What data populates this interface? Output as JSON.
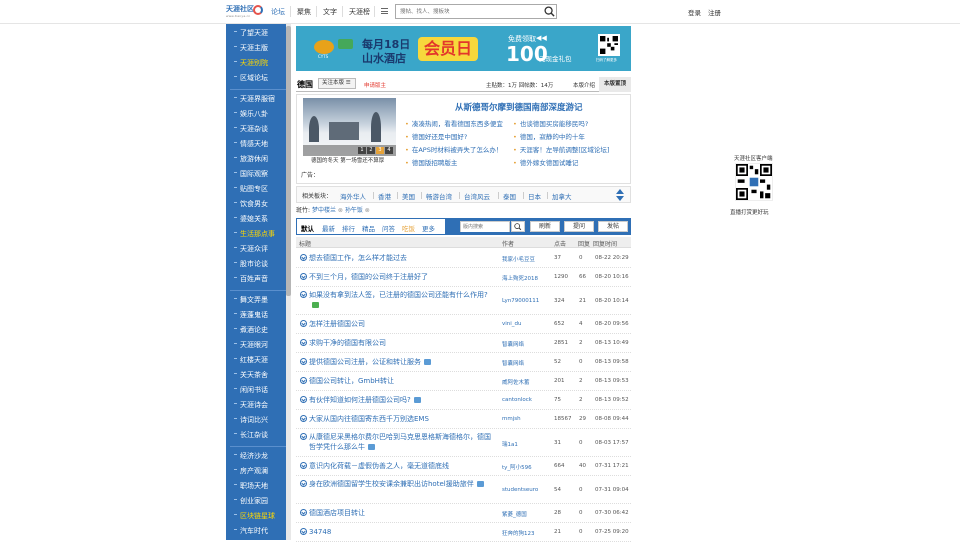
{
  "topbar": {
    "logo_text": "天涯社区",
    "logo_sub": "www.tianya.cn",
    "nav": [
      "论坛",
      "聚焦",
      "文字",
      "天涯榜"
    ],
    "search_placeholder": "搜帖、找人、搜板块",
    "login": "登录",
    "register": "注册"
  },
  "sidebar": {
    "items": [
      {
        "label": "了望天涯",
        "hl": false
      },
      {
        "label": "天涯主版",
        "hl": false
      },
      {
        "label": "天涯别院",
        "hl": true
      },
      {
        "label": "区域论坛",
        "hl": false
      },
      {
        "label": "天涯界服宿",
        "hl": false
      },
      {
        "label": "娱乐八卦",
        "hl": false
      },
      {
        "label": "天涯杂谈",
        "hl": false
      },
      {
        "label": "情感天地",
        "hl": false
      },
      {
        "label": "旅游休闲",
        "hl": false
      },
      {
        "label": "国际观察",
        "hl": false
      },
      {
        "label": "贴图专区",
        "hl": false
      },
      {
        "label": "饮食男女",
        "hl": false
      },
      {
        "label": "婆媳关系",
        "hl": false
      },
      {
        "label": "生活那点事",
        "hl": true
      },
      {
        "label": "天涯众评",
        "hl": false
      },
      {
        "label": "股市论谈",
        "hl": false
      },
      {
        "label": "百姓声音",
        "hl": false
      },
      {
        "label": "舞文弄墨",
        "hl": false
      },
      {
        "label": "莲蓬鬼话",
        "hl": false
      },
      {
        "label": "煮酒论史",
        "hl": false
      },
      {
        "label": "天涯眼河",
        "hl": false
      },
      {
        "label": "红楼天涯",
        "hl": false
      },
      {
        "label": "关天茶舍",
        "hl": false
      },
      {
        "label": "闲闲书话",
        "hl": false
      },
      {
        "label": "天涯诗会",
        "hl": false
      },
      {
        "label": "诗词比兴",
        "hl": false
      },
      {
        "label": "长江杂谈",
        "hl": false
      },
      {
        "label": "经济沙龙",
        "hl": false
      },
      {
        "label": "房产观澜",
        "hl": false
      },
      {
        "label": "职场天地",
        "hl": false
      },
      {
        "label": "创业家园",
        "hl": false
      },
      {
        "label": "区块链星球",
        "hl": true
      },
      {
        "label": "汽车时代",
        "hl": false
      }
    ]
  },
  "banner": {
    "brand": "CYTS",
    "brand_sub": "中青旅",
    "line1": "每月18日",
    "line2": "山水酒店",
    "tag": "会员日",
    "free": "免费领取",
    "amount": "100",
    "amount_sub": "元现金礼包",
    "qr_label": "扫码了解更多"
  },
  "board": {
    "name": "德国",
    "follow": "关注本版",
    "apply": "申请版主",
    "stats": "主贴数：1万 回帖数：14万",
    "intro": "本版介绍",
    "top_tab": "本版置顶"
  },
  "featured": {
    "title": "从斯德哥尔摩到德国南部深度游记",
    "photo_caption": "德国的冬天 第一场雪还不算厚",
    "slide_nums": [
      "1",
      "2",
      "3",
      "4"
    ],
    "links_left": [
      "凑凑热闹，看看德国东西多便宜",
      "德国好还是中国好?",
      "在APS时材料被弄失了怎么办！",
      "德国版招聘版主"
    ],
    "links_right": [
      "也谈德国买房能移民吗?",
      "德国，寂静的中的十年",
      "天涯客！左导航调整[区域论坛]",
      "德外嫁女德国试睡记"
    ],
    "ad_label": "广告："
  },
  "related": {
    "label": "相关板块：",
    "items": [
      "海外华人",
      "香港",
      "美国",
      "畅游台湾",
      "台湾风云",
      "泰国",
      "日本",
      "加拿大"
    ]
  },
  "moderators": {
    "label": "斑竹:",
    "names": [
      "梦中楼兰",
      "孙午饭"
    ]
  },
  "toolbar": {
    "tabs": [
      "默认",
      "最新",
      "排行",
      "精品",
      "问答",
      "吃饭",
      "更多"
    ],
    "search_placeholder": "版内搜索",
    "refresh": "刷新",
    "ask": "提问",
    "post": "发帖"
  },
  "table": {
    "headers": {
      "title": "标题",
      "author": "作者",
      "clicks": "点击",
      "replies": "回复",
      "time": "回复时间"
    },
    "rows": [
      {
        "title": "想去德国工作，怎么样才能过去",
        "author": "我家小毛豆豆",
        "clicks": "37",
        "replies": "0",
        "time": "08-22 20:29",
        "badge": ""
      },
      {
        "title": "不到三个月，德国的公司终于注册好了",
        "author": "海上殉死2018",
        "clicks": "1290",
        "replies": "66",
        "time": "08-20 10:16",
        "badge": ""
      },
      {
        "title": "如果没有拿到法人签，已注册的德国公司还能有什么作用?",
        "author": "Lyn79000111",
        "clicks": "324",
        "replies": "21",
        "time": "08-20 10:14",
        "badge": "pic"
      },
      {
        "title": "怎样注册德国公司",
        "author": "vini_du",
        "clicks": "652",
        "replies": "4",
        "time": "08-20 09:56",
        "badge": ""
      },
      {
        "title": "求购干净的德国有限公司",
        "author": "智囊网络",
        "clicks": "2851",
        "replies": "2",
        "time": "08-13 10:49",
        "badge": ""
      },
      {
        "title": "提供德国公司注册，公证和转让服务",
        "author": "智囊网络",
        "clicks": "52",
        "replies": "0",
        "time": "08-13 09:58",
        "badge": "img"
      },
      {
        "title": "德国公司转让，GmbH转让",
        "author": "威阿佐木蓄",
        "clicks": "201",
        "replies": "2",
        "time": "08-13 09:53",
        "badge": ""
      },
      {
        "title": "有伙伴知道如何注册德国公司吗?",
        "author": "cantonlock",
        "clicks": "75",
        "replies": "2",
        "time": "08-13 09:52",
        "badge": "img"
      },
      {
        "title": "大家从国内往德国寄东西千万别选EMS",
        "author": "mmjsh",
        "clicks": "18567",
        "replies": "29",
        "time": "08-08 09:44",
        "badge": ""
      },
      {
        "title": "从康德尼采黑格尔费尔巴哈到马克思恩格斯海德格尔，德国哲学凭什么那么牛",
        "author": "瑞1a1",
        "clicks": "31",
        "replies": "0",
        "time": "08-03 17:57",
        "badge": "img"
      },
      {
        "title": "意识内化荷载－虚假伪善之人，毫无道德底线",
        "author": "ty_阿小596",
        "clicks": "664",
        "replies": "40",
        "time": "07-31 17:21",
        "badge": ""
      },
      {
        "title": "身在欧洲德国留学生校安课余兼职出访hotel援助旅伴",
        "author": "studentseuro",
        "clicks": "54",
        "replies": "0",
        "time": "07-31 09:04",
        "badge": "img"
      },
      {
        "title": "德国酒店项目转让",
        "author": "紫菱_德国",
        "clicks": "28",
        "replies": "0",
        "time": "07-30 06:42",
        "badge": ""
      },
      {
        "title": "34748",
        "author": "狂奔的狗123",
        "clicks": "21",
        "replies": "0",
        "time": "07-25 09:20",
        "badge": ""
      }
    ]
  },
  "qr": {
    "top": "天涯社区客户端",
    "bottom": "直播打赏更好玩"
  },
  "colors": {
    "primary": "#2f6fb5",
    "highlight": "#ffd800",
    "orange": "#e6a33a",
    "red": "#e3362b"
  }
}
